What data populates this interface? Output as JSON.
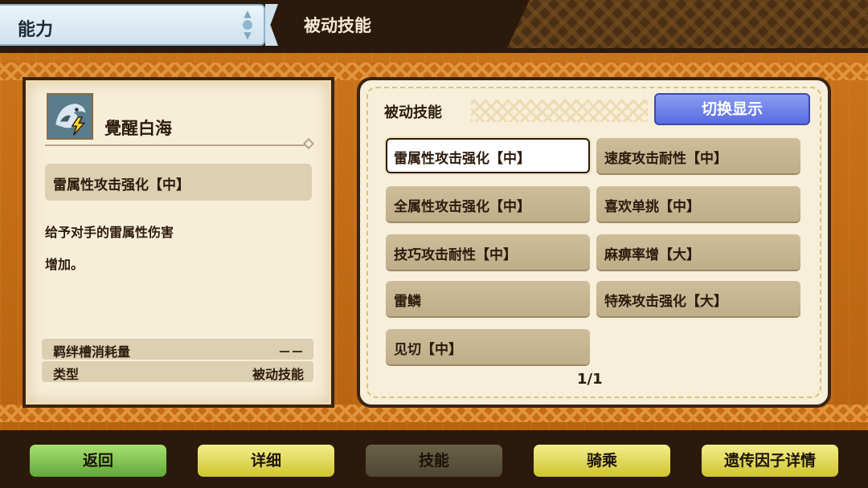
{
  "header": {
    "category": "能力",
    "screen_title": "被动技能"
  },
  "monster": {
    "name": "覺醒白海",
    "icon": "zinogre-thunder-icon"
  },
  "detail": {
    "selected_skill": "雷属性攻击强化【中】",
    "description": "给予对手的雷属性伤害\n增加。",
    "bond_cost_label": "羁绊槽消耗量",
    "bond_cost_value": "－－",
    "type_label": "类型",
    "type_value": "被动技能"
  },
  "skills_panel": {
    "title": "被动技能",
    "toggle_label": "切换显示",
    "page": "1/1",
    "skills": [
      {
        "label": "雷属性攻击强化【中】",
        "selected": true
      },
      {
        "label": "速度攻击耐性【中】",
        "selected": false
      },
      {
        "label": "全属性攻击强化【中】",
        "selected": false
      },
      {
        "label": "喜欢单挑【中】",
        "selected": false
      },
      {
        "label": "技巧攻击耐性【中】",
        "selected": false
      },
      {
        "label": "麻痹率增【大】",
        "selected": false
      },
      {
        "label": "雷鳞",
        "selected": false
      },
      {
        "label": "特殊攻击强化【大】",
        "selected": false
      },
      {
        "label": "见切【中】",
        "selected": false
      }
    ]
  },
  "nav": {
    "back": "返回",
    "details": "详细",
    "skills": "技能",
    "ride": "骑乘",
    "genes": "遗传因子详情"
  },
  "colors": {
    "nav_green": "#5fa83a",
    "nav_yellow": "#cfc431",
    "toggle_blue": "#5a6ce0",
    "panel_bg": "#f8efdb"
  }
}
